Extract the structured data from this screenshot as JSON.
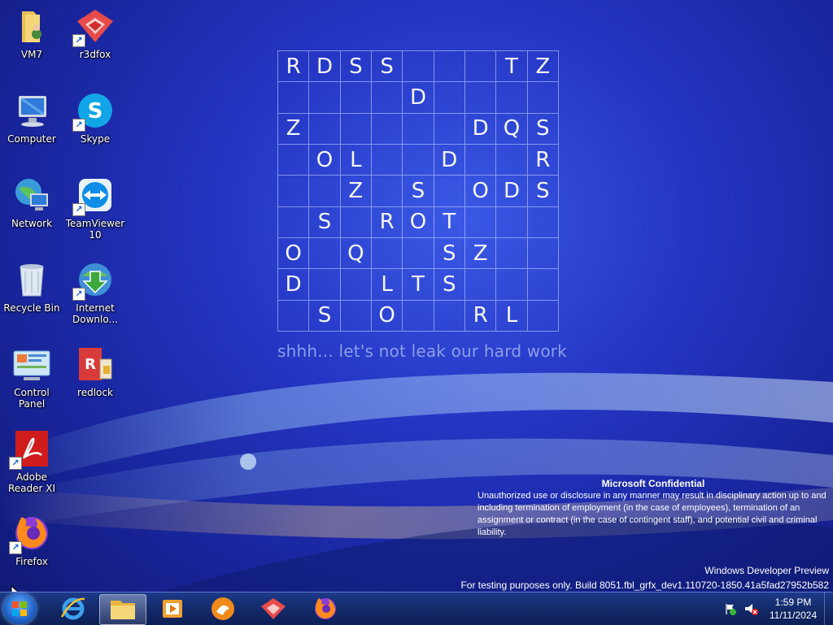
{
  "desktop": {
    "icons": [
      {
        "label": "VM7"
      },
      {
        "label": "r3dfox"
      },
      {
        "label": "Computer"
      },
      {
        "label": "Skype"
      },
      {
        "label": "Network"
      },
      {
        "label": "TeamViewer 10"
      },
      {
        "label": "Recycle Bin"
      },
      {
        "label": "Internet Downlo..."
      },
      {
        "label": "Control Panel"
      },
      {
        "label": "redlock"
      },
      {
        "label": "Adobe Reader XI"
      },
      {
        "label": "Firefox"
      }
    ]
  },
  "wallpaper": {
    "grid_rows": [
      [
        "R",
        "D",
        "S",
        "S",
        "",
        "",
        "",
        "T",
        "Z"
      ],
      [
        "",
        "",
        "",
        "",
        "D",
        "",
        "",
        "",
        ""
      ],
      [
        "Z",
        "",
        "",
        "",
        "",
        "",
        "D",
        "Q",
        "S"
      ],
      [
        "",
        "O",
        "L",
        "",
        "",
        "D",
        "",
        "",
        "R"
      ],
      [
        "",
        "",
        "Z",
        "",
        "S",
        "",
        "O",
        "D",
        "S"
      ],
      [
        "",
        "S",
        "",
        "R",
        "O",
        "T",
        "",
        "",
        ""
      ],
      [
        "O",
        "",
        "Q",
        "",
        "",
        "S",
        "Z",
        "",
        ""
      ],
      [
        "D",
        "",
        "",
        "L",
        "T",
        "S",
        "",
        "",
        ""
      ],
      [
        "",
        "S",
        "",
        "O",
        "",
        "",
        "R",
        "L",
        ""
      ]
    ],
    "tagline": "shhh... let's not leak our hard work",
    "confidential_title": "Microsoft Confidential",
    "confidential_text": "Unauthorized use or disclosure in any manner may result in disciplinary action up to and including termination of employment (in the case of employees), termination of an assignment or contract (in the case of contingent staff), and potential civil and criminal liability.",
    "edition": "Windows Developer Preview",
    "build": "For testing purposes only. Build 8051.fbl_grfx_dev1.110720-1850.41a5fad27952b582"
  },
  "taskbar": {
    "pinned": [
      "internet-explorer-icon",
      "file-explorer-icon",
      "media-player-icon",
      "uc-browser-icon",
      "r3dfox-icon",
      "firefox-icon"
    ],
    "clock_time": "1:59 PM",
    "clock_date": "11/11/2024"
  },
  "colors": {
    "accent": "#2436c4",
    "grid_line": "#bfcdff",
    "tagline": "#8b9eea"
  }
}
